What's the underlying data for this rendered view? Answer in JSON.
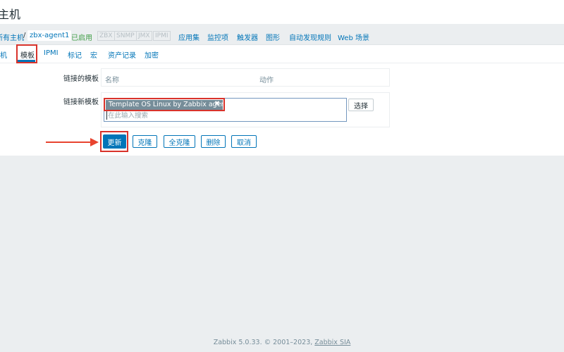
{
  "page": {
    "title": "主机"
  },
  "breadcrumb": {
    "all_hosts": "所有主机",
    "separator": "/",
    "host": "zbx-agent1",
    "status": "已启用",
    "availability": [
      "ZBX",
      "SNMP",
      "JMX",
      "IPMI"
    ],
    "nav": [
      "应用集",
      "监控项",
      "触发器",
      "图形",
      "自动发现规则",
      "Web 场景"
    ]
  },
  "tabs": [
    "主机",
    "模板",
    "IPMI",
    "标记",
    "宏",
    "资产记录",
    "加密"
  ],
  "active_tab": "模板",
  "form": {
    "linked_label": "链接的模板",
    "col_name": "名称",
    "col_action": "动作",
    "new_label": "链接新模板",
    "selected_template": "Template OS Linux by Zabbix agent",
    "remove_symbol": "✖",
    "search_placeholder": "在此输入搜索",
    "select_button": "选择"
  },
  "buttons": {
    "update": "更新",
    "clone": "克隆",
    "full_clone": "全克隆",
    "delete": "删除",
    "cancel": "取消"
  },
  "footer": {
    "text": "Zabbix 5.0.33. © 2001–2023, ",
    "company": "Zabbix SIA"
  },
  "colors": {
    "accent": "#0275b8",
    "annotation": "#d9332b",
    "enabled": "#429e47"
  }
}
